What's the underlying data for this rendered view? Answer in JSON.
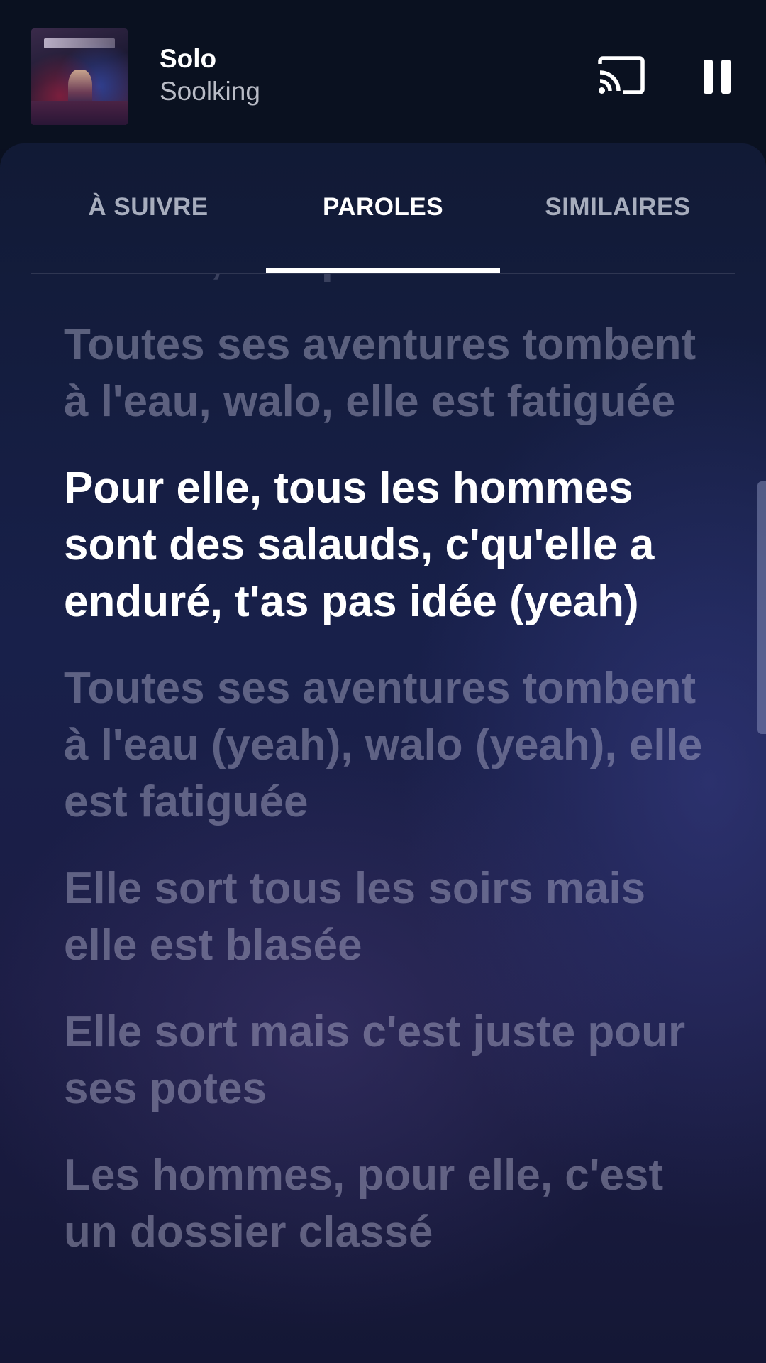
{
  "now_playing": {
    "title": "Solo",
    "artist": "Soolking",
    "album_art_icon": "album-cover-image",
    "cast_icon": "cast-icon",
    "pause_icon": "pause-icon"
  },
  "tabs": [
    {
      "label": "À SUIVRE",
      "active": false
    },
    {
      "label": "PAROLES",
      "active": true
    },
    {
      "label": "SIMILAIRES",
      "active": false
    }
  ],
  "lyrics": [
    {
      "text": "enduré, t'as pas idée",
      "state": "past"
    },
    {
      "text": "Toutes ses aventures tombent à l'eau, walo, elle est fatiguée",
      "state": "past"
    },
    {
      "text": "Pour elle, tous les hommes sont des salauds, c'qu'elle a enduré, t'as pas idée (yeah)",
      "state": "current"
    },
    {
      "text": "Toutes ses aventures tombent à l'eau (yeah), walo (yeah), elle est fatiguée",
      "state": "upcoming"
    },
    {
      "text": "Elle sort tous les soirs mais elle est blasée",
      "state": "upcoming"
    },
    {
      "text": "Elle sort mais c'est juste pour ses potes",
      "state": "upcoming"
    },
    {
      "text": "Les hommes, pour elle, c'est un dossier classé",
      "state": "upcoming"
    }
  ],
  "colors": {
    "active_text": "#ffffff",
    "inactive_tab": "#a7adbd",
    "background": "#18204a"
  }
}
